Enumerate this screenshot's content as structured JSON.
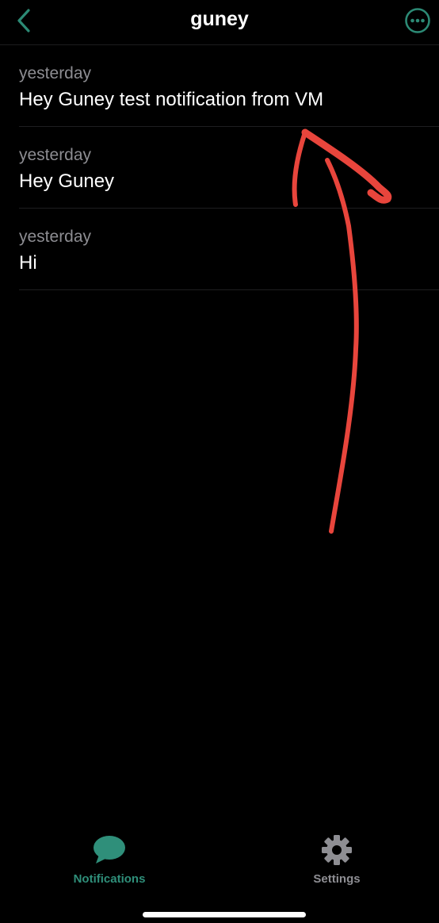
{
  "nav": {
    "title": "guney",
    "back_icon": "chevron-left-icon",
    "more_icon": "ellipsis-circle-icon",
    "accent_color": "#2c8a75"
  },
  "notifications": [
    {
      "time": "yesterday",
      "message": "Hey Guney test notification from VM"
    },
    {
      "time": "yesterday",
      "message": "Hey Guney"
    },
    {
      "time": "yesterday",
      "message": "Hi"
    }
  ],
  "annotation": {
    "type": "hand-drawn arrow",
    "color": "#e8453c"
  },
  "tabbar": {
    "tabs": [
      {
        "label": "Notifications",
        "icon": "chat-bubble-icon",
        "active": true,
        "color": "#2f8f7a"
      },
      {
        "label": "Settings",
        "icon": "gear-icon",
        "active": false,
        "color": "#8e8e93"
      }
    ]
  }
}
